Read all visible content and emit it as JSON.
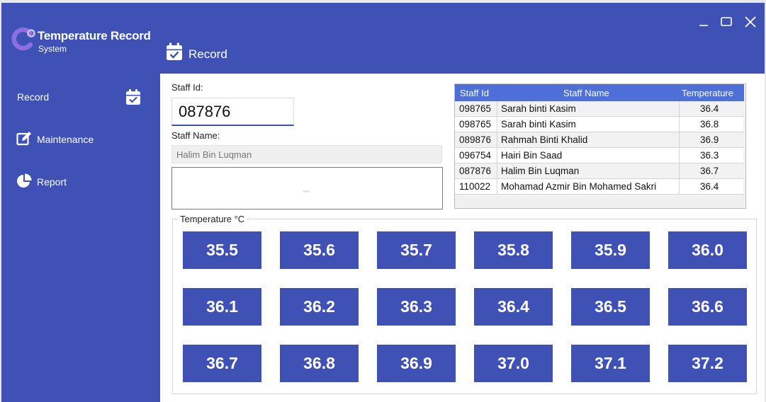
{
  "brand": {
    "title": "Temperature Record",
    "subtitle": "System"
  },
  "window_controls": {
    "minimize": "minimize",
    "maximize": "maximize",
    "close": "close"
  },
  "sidebar": {
    "items": [
      {
        "label": "Record",
        "icon": "calendar-check-icon"
      },
      {
        "label": "Maintenance",
        "icon": "edit-icon"
      },
      {
        "label": "Report",
        "icon": "pie-chart-icon"
      }
    ]
  },
  "header": {
    "title": "Record",
    "icon": "calendar-check-icon"
  },
  "form": {
    "staff_id_label": "Staff Id:",
    "staff_id_value": "087876",
    "staff_name_label": "Staff Name:",
    "staff_name_value": "Halim Bin Luqman"
  },
  "table": {
    "columns": [
      "Staff Id",
      "Staff Name",
      "Temperature"
    ],
    "rows": [
      [
        "098765",
        "Sarah binti Kasim",
        "36.4"
      ],
      [
        "098765",
        "Sarah binti Kasim",
        "36.8"
      ],
      [
        "089876",
        "Rahmah Binti Khalid",
        "36.9"
      ],
      [
        "096754",
        "Hairi Bin Saad",
        "36.3"
      ],
      [
        "087876",
        "Halim Bin Luqman",
        "36.7"
      ],
      [
        "110022",
        "Mohamad Azmir Bin Mohamed Sakri",
        "36.4"
      ]
    ]
  },
  "temperature": {
    "legend": "Temperature °C",
    "values": [
      "35.5",
      "35.6",
      "35.7",
      "35.8",
      "35.9",
      "36.0",
      "36.1",
      "36.2",
      "36.3",
      "36.4",
      "36.5",
      "36.6",
      "36.7",
      "36.8",
      "36.9",
      "37.0",
      "37.1",
      "37.2"
    ]
  },
  "colors": {
    "primary": "#3f51b5",
    "grid_header": "#4f6fd8",
    "logo_accent": "#8e6fe0"
  }
}
